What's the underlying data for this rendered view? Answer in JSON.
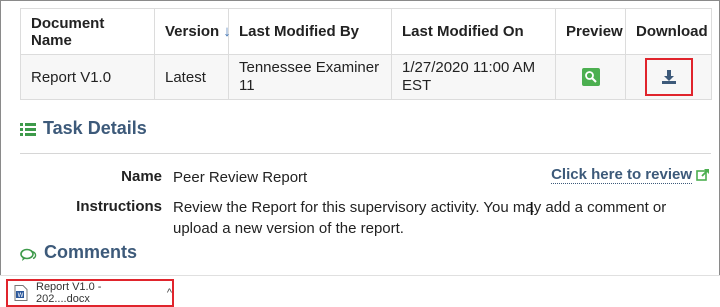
{
  "documents": {
    "headers": {
      "name": "Document Name",
      "version": "Version",
      "version_sort": "↓",
      "modified_by": "Last Modified By",
      "modified_on": "Last Modified On",
      "preview": "Preview",
      "download": "Download"
    },
    "rows": [
      {
        "name": "Report V1.0",
        "version": "Latest",
        "modified_by": "Tennessee Examiner 11",
        "modified_on": "1/27/2020 11:00 AM EST"
      }
    ]
  },
  "task_details": {
    "title": "Task Details",
    "name_label": "Name",
    "name_value": "Peer Review Report",
    "review_link": "Click here to review",
    "instructions_label": "Instructions",
    "instructions_value": "Review the Report for this supervisory activity. You may add a comment or upload a new version of the report."
  },
  "comments": {
    "title": "Comments"
  },
  "download_bar": {
    "file_label": "Report V1.0 - 202....docx",
    "chevron": "^"
  },
  "colors": {
    "heading": "#3d5a7a",
    "accent_green": "#4caf50",
    "highlight_red": "#e0242c"
  }
}
